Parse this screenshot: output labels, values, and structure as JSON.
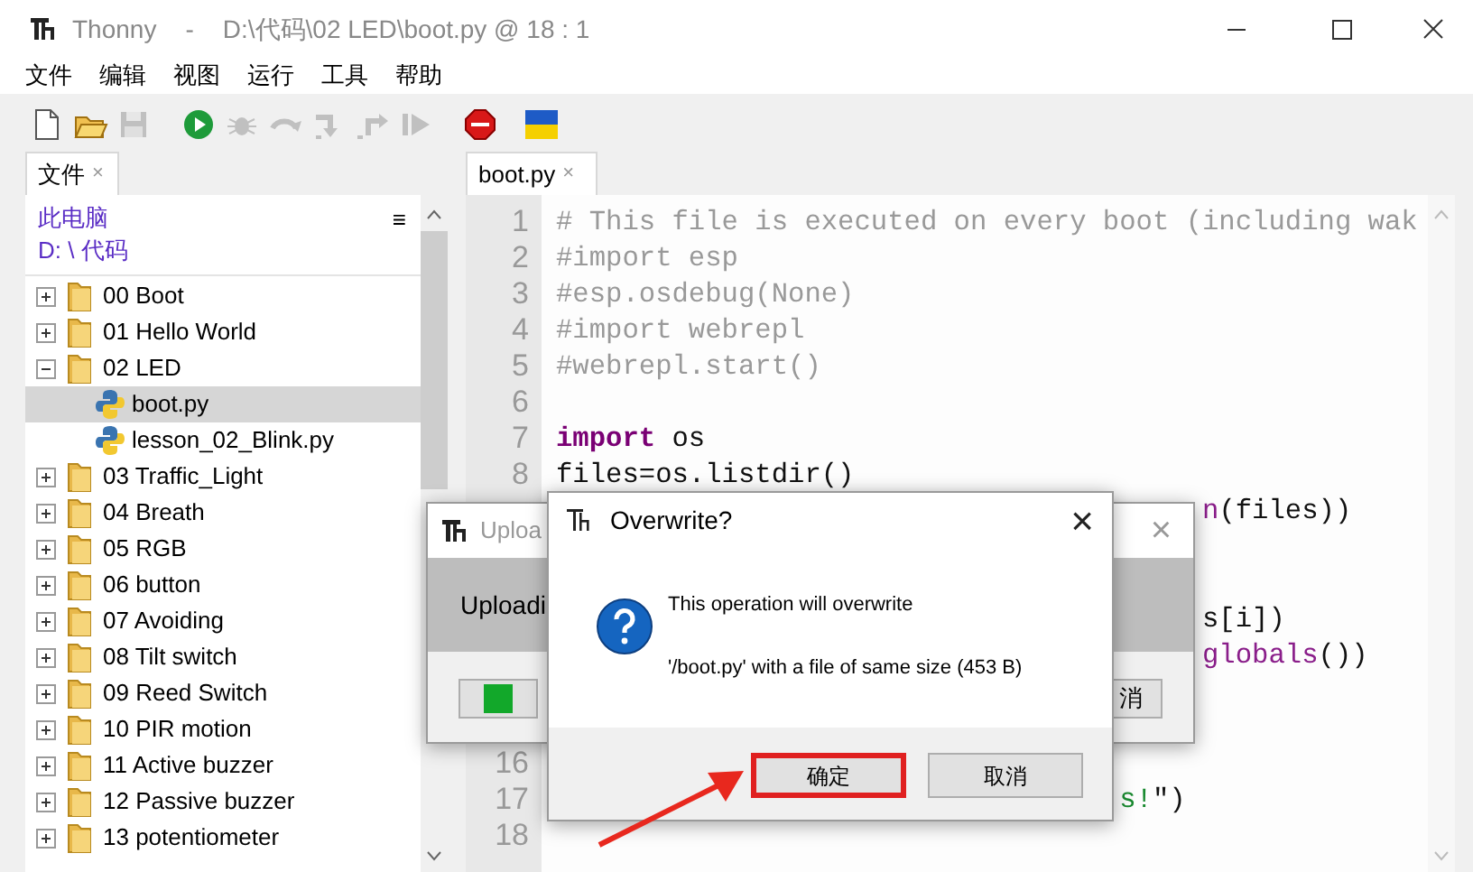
{
  "window": {
    "app": "Thonny",
    "separator": "-",
    "title": "D:\\代码\\02 LED\\boot.py  @  18 : 1"
  },
  "menu": [
    "文件",
    "编辑",
    "视图",
    "运行",
    "工具",
    "帮助"
  ],
  "toolbar": [
    {
      "kind": "new",
      "disabled": false
    },
    {
      "kind": "open",
      "disabled": false
    },
    {
      "kind": "save",
      "disabled": true
    },
    {
      "kind": "run",
      "disabled": false
    },
    {
      "kind": "debug",
      "disabled": true
    },
    {
      "kind": "step_over",
      "disabled": true
    },
    {
      "kind": "step_into",
      "disabled": true
    },
    {
      "kind": "step_out",
      "disabled": true
    },
    {
      "kind": "resume",
      "disabled": true
    },
    {
      "kind": "stop",
      "disabled": false
    },
    {
      "kind": "flag",
      "disabled": false
    }
  ],
  "files_panel": {
    "tab": {
      "label": "文件",
      "close": "×"
    },
    "location": "此电脑",
    "path": "D: \\ 代码",
    "menu": "≡",
    "tree": [
      {
        "kind": "folder",
        "name": "00 Boot",
        "expanded": false,
        "selected": false
      },
      {
        "kind": "folder",
        "name": "01 Hello World",
        "expanded": false,
        "selected": false
      },
      {
        "kind": "folder",
        "name": "02 LED",
        "expanded": true,
        "selected": false,
        "children": [
          {
            "kind": "file",
            "name": "boot.py",
            "selected": true
          },
          {
            "kind": "file",
            "name": "lesson_02_Blink.py",
            "selected": false
          }
        ]
      },
      {
        "kind": "folder",
        "name": "03 Traffic_Light",
        "expanded": false,
        "selected": false
      },
      {
        "kind": "folder",
        "name": "04 Breath",
        "expanded": false,
        "selected": false
      },
      {
        "kind": "folder",
        "name": "05 RGB",
        "expanded": false,
        "selected": false
      },
      {
        "kind": "folder",
        "name": "06 button",
        "expanded": false,
        "selected": false
      },
      {
        "kind": "folder",
        "name": "07 Avoiding",
        "expanded": false,
        "selected": false
      },
      {
        "kind": "folder",
        "name": "08 Tilt switch",
        "expanded": false,
        "selected": false
      },
      {
        "kind": "folder",
        "name": "09 Reed Switch",
        "expanded": false,
        "selected": false
      },
      {
        "kind": "folder",
        "name": "10 PIR motion",
        "expanded": false,
        "selected": false
      },
      {
        "kind": "folder",
        "name": "11 Active buzzer",
        "expanded": false,
        "selected": false
      },
      {
        "kind": "folder",
        "name": "12 Passive buzzer",
        "expanded": false,
        "selected": false
      },
      {
        "kind": "folder",
        "name": "13 potentiometer",
        "expanded": false,
        "selected": false
      }
    ]
  },
  "editor": {
    "tab": {
      "label": "boot.py",
      "close": "×"
    },
    "lines": [
      {
        "number": "1",
        "segments": [
          {
            "kind": "comment",
            "text": "# This file is executed on every boot (including wak"
          }
        ]
      },
      {
        "number": "2",
        "segments": [
          {
            "kind": "comment",
            "text": "#import esp"
          }
        ]
      },
      {
        "number": "3",
        "segments": [
          {
            "kind": "comment",
            "text": "#esp.osdebug(None)"
          }
        ]
      },
      {
        "number": "4",
        "segments": [
          {
            "kind": "comment",
            "text": "#import webrepl"
          }
        ]
      },
      {
        "number": "5",
        "segments": [
          {
            "kind": "comment",
            "text": "#webrepl.start()"
          }
        ]
      },
      {
        "number": "6"
      },
      {
        "number": "7",
        "segments": [
          {
            "kind": "keyword",
            "text": "import"
          },
          {
            "kind": "plain",
            "text": " os"
          }
        ]
      },
      {
        "number": "8",
        "segments": [
          {
            "kind": "plain",
            "text": "files=os.listdir()"
          }
        ]
      },
      {
        "segments": [
          {
            "kind": "builtin",
            "text": "n"
          },
          {
            "kind": "plain",
            "text": "(files))"
          }
        ]
      },
      {
        "segments": [
          {
            "kind": "plain",
            "text": "s[i])"
          }
        ]
      },
      {
        "segments": [
          {
            "kind": "builtin",
            "text": "globals"
          },
          {
            "kind": "plain",
            "text": "())"
          }
        ]
      },
      {
        "number": "16"
      },
      {
        "number": "17",
        "segments": [
          {
            "kind": "string",
            "text": "s!"
          },
          {
            "kind": "plain",
            "text": "\")"
          }
        ]
      },
      {
        "number": "18"
      }
    ]
  },
  "upload_dialog": {
    "title": "Uploa",
    "close": "×",
    "message": "Uploadi",
    "cancel": "消"
  },
  "overwrite_dialog": {
    "title": "Overwrite?",
    "close": "×",
    "message": "This operation will overwrite",
    "detail": "'/boot.py' with a file of same size (453 B)",
    "buttons": [
      {
        "label": "确定",
        "highlighted": true
      },
      {
        "label": "取消",
        "highlighted": false
      }
    ]
  },
  "annotations": [
    {
      "kind": "arrow"
    }
  ]
}
